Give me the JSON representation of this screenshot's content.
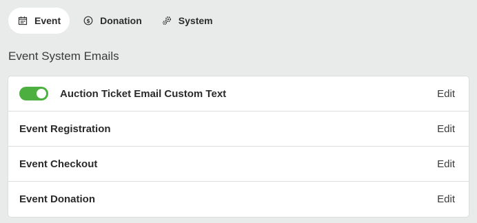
{
  "tabs": [
    {
      "label": "Event",
      "icon": "calendar-icon",
      "active": true
    },
    {
      "label": "Donation",
      "icon": "dollar-circle-icon",
      "active": false
    },
    {
      "label": "System",
      "icon": "gears-icon",
      "active": false
    }
  ],
  "section": {
    "title": "Event System Emails"
  },
  "emails": [
    {
      "label": "Auction Ticket Email Custom Text",
      "edit": "Edit",
      "toggle_on": true
    },
    {
      "label": "Event Registration",
      "edit": "Edit"
    },
    {
      "label": "Event Checkout",
      "edit": "Edit"
    },
    {
      "label": "Event Donation",
      "edit": "Edit"
    }
  ],
  "colors": {
    "background": "#e9ebeb",
    "toggle_on": "#4caf3f",
    "card": "#ffffff"
  }
}
